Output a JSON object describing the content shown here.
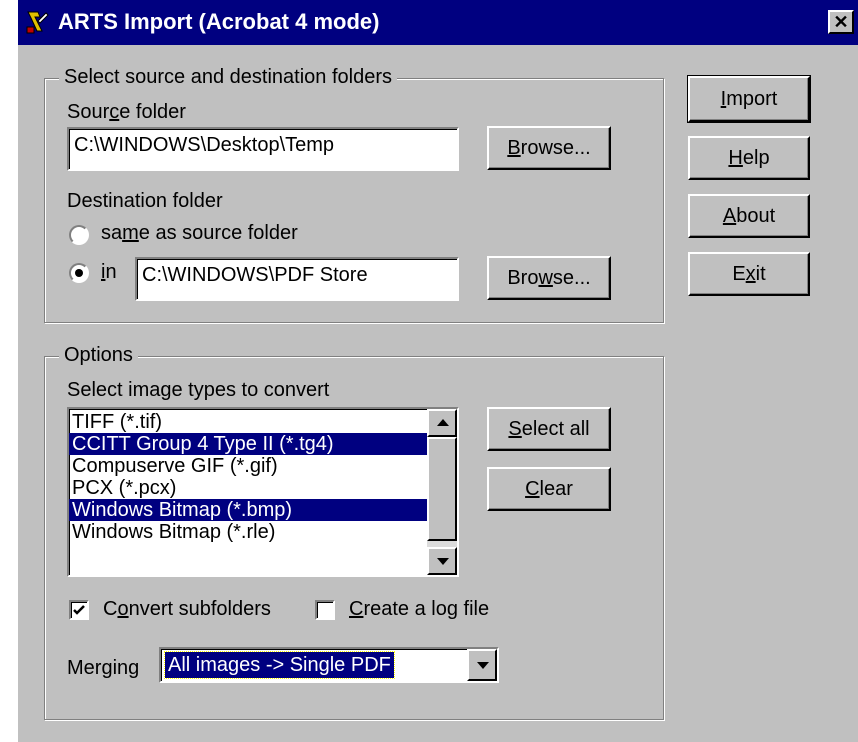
{
  "window": {
    "title": "ARTS Import (Acrobat 4 mode)",
    "close_glyph": "✕",
    "icon": "app-icon"
  },
  "folders": {
    "legend": "Select source and destination folders",
    "source_label_pre": "Sour",
    "source_label_key": "c",
    "source_label_post": "e folder",
    "source_value": "C:\\WINDOWS\\Desktop\\Temp",
    "browse1": {
      "pre": "",
      "key": "B",
      "post": "rowse..."
    },
    "dest_label": "Destination folder",
    "same_pre": "sa",
    "same_key": "m",
    "same_post": "e as source folder",
    "same_selected": false,
    "in_key": "i",
    "in_post": "n",
    "in_selected": true,
    "dest_value": "C:\\WINDOWS\\PDF Store",
    "browse2": {
      "pre": "Bro",
      "key": "w",
      "post": "se..."
    }
  },
  "buttons": {
    "import": {
      "pre": "",
      "key": "I",
      "post": "mport"
    },
    "help": {
      "pre": "",
      "key": "H",
      "post": "elp"
    },
    "about": {
      "pre": "",
      "key": "A",
      "post": "bout"
    },
    "exit": {
      "pre": "E",
      "key": "x",
      "post": "it"
    }
  },
  "options": {
    "legend": "Options",
    "types_label": "Select image types to convert",
    "image_types": [
      {
        "label": "TIFF (*.tif)",
        "selected": false
      },
      {
        "label": "CCITT Group 4 Type II (*.tg4)",
        "selected": true
      },
      {
        "label": "Compuserve GIF (*.gif)",
        "selected": false
      },
      {
        "label": "PCX (*.pcx)",
        "selected": false
      },
      {
        "label": "Windows Bitmap (*.bmp)",
        "selected": true
      },
      {
        "label": "Windows Bitmap (*.rle)",
        "selected": false
      }
    ],
    "select_all": {
      "pre": "",
      "key": "S",
      "post": "elect all"
    },
    "clear": {
      "pre": "",
      "key": "C",
      "post": "lear"
    },
    "convert_subfolders": {
      "pre": "C",
      "key": "o",
      "post": "nvert subfolders",
      "checked": true
    },
    "log_file": {
      "pre": "",
      "key": "C",
      "post": "reate a log file",
      "checked": false
    },
    "merging_label": "Merging",
    "merging_value": "All images -> Single PDF"
  }
}
